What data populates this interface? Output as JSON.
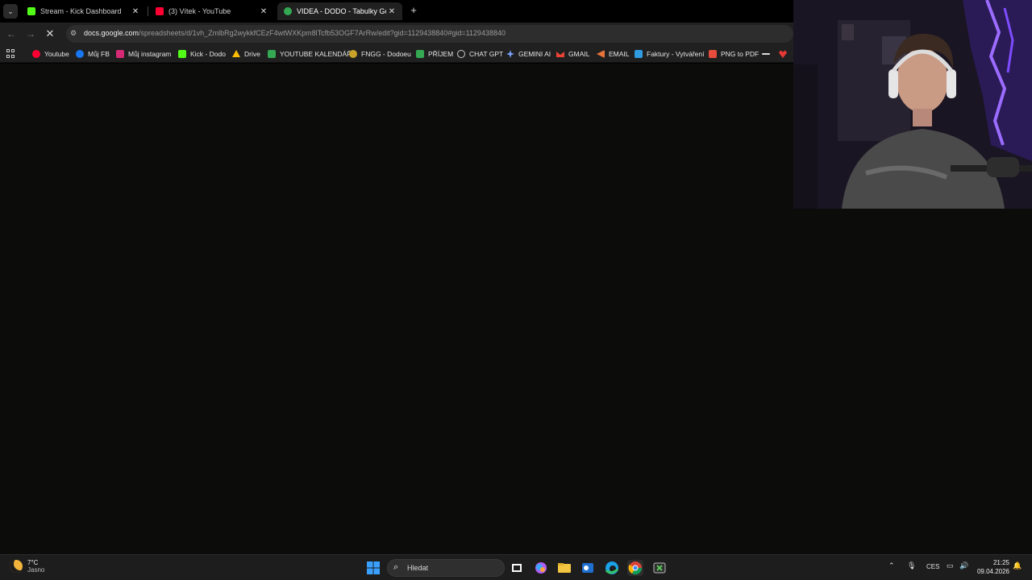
{
  "browser": {
    "tabs": [
      {
        "title": "Stream - Kick Dashboard",
        "favicon_color": "#53fc18",
        "active": false
      },
      {
        "title": "(3) Vítek - YouTube",
        "favicon_color": "#ff0033",
        "active": false
      },
      {
        "title": "VIDEA - DODO - Tabulky Goog",
        "favicon_color": "#34a853",
        "active": true
      }
    ],
    "new_tab": "+",
    "close": "✕",
    "url_host": "docs.google.com",
    "url_path": "/spreadsheets/d/1vh_ZmlbRg2wykkfCEzF4wtWXKpm8lTcfb53OGF7ArRw/edit?gid=1129438840#gid=1129438840",
    "bookmarks": [
      {
        "label": "Youtube",
        "color": "#ff0033"
      },
      {
        "label": "Můj FB",
        "color": "#1877f2"
      },
      {
        "label": "Můj instagram",
        "color": "#d62976"
      },
      {
        "label": "Kick - Dodo",
        "color": "#53fc18"
      },
      {
        "label": "Drive",
        "color": "#fbbc04"
      },
      {
        "label": "YOUTUBE KALENDÁŘ",
        "color": "#34a853"
      },
      {
        "label": "FNGG - Dodoeu",
        "color": "#c9a227"
      },
      {
        "label": "PŘÍJEM",
        "color": "#34a853"
      },
      {
        "label": "CHAT GPT",
        "color": "#cccccc"
      },
      {
        "label": "GEMINI AI",
        "color": "#7aa2ff"
      },
      {
        "label": "GMAIL",
        "color": "#ea4335"
      },
      {
        "label": "EMAIL",
        "color": "#e8743b"
      },
      {
        "label": "Faktury - Vytváření",
        "color": "#2f9be0"
      },
      {
        "label": "PNG to PDF",
        "color": "#e74c3c"
      }
    ]
  },
  "taskbar": {
    "weather_temp": "7°C",
    "weather_desc": "Jasno",
    "search_placeholder": "Hledat",
    "language": "CES",
    "time": "21:25",
    "date": "09.04.2026"
  }
}
